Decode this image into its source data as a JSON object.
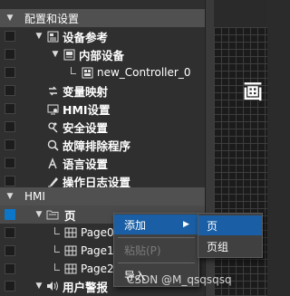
{
  "tree": {
    "section_config": "配置和设置",
    "device_ref": "设备参考",
    "internal_device": "内部设备",
    "controller": "new_Controller_0",
    "var_mapping": "变量映射",
    "hmi_settings": "HMI设置",
    "security_settings": "安全设置",
    "troubleshooting": "故障排除程序",
    "language_settings": "语言设置",
    "op_log_settings": "操作日志设置",
    "section_hmi": "HMI",
    "page_folder": "页",
    "pages": [
      "Page0",
      "Page1",
      "Page2"
    ],
    "user_alarm": "用户警报"
  },
  "canvas": {
    "glyph": "画"
  },
  "context_menu": {
    "add": "添加",
    "paste": "粘贴(P)",
    "import": "导入"
  },
  "submenu": {
    "page": "页",
    "page_group": "页组"
  },
  "watermark": "CSDN @M_qsqsqsq",
  "colors": {
    "selection": "#0c76c8",
    "menu_active": "#1a5fa5"
  }
}
